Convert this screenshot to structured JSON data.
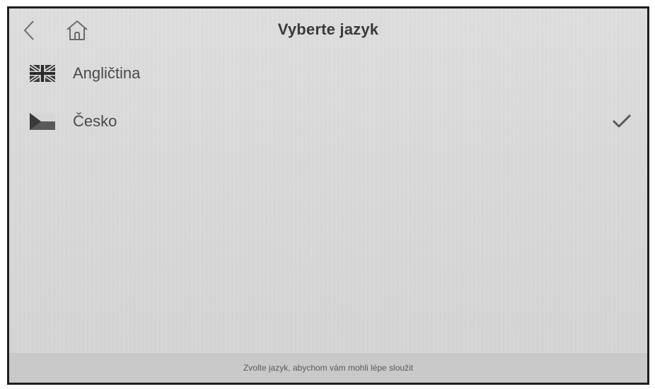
{
  "header": {
    "title": "Vyberte jazyk",
    "back_icon": "chevron-left-icon",
    "home_icon": "home-icon"
  },
  "languages": [
    {
      "label": "Angličtina",
      "flag_icon": "uk-flag-icon",
      "selected": false
    },
    {
      "label": "Česko",
      "flag_icon": "czech-flag-icon",
      "selected": true
    }
  ],
  "footer": {
    "text": "Zvolte jazyk, abychom vám mohli lépe sloužit"
  },
  "colors": {
    "background": "#d9d9d9",
    "text": "#4a4a4a",
    "title": "#3a3a3a",
    "footer_bg": "#c9c9c9"
  }
}
